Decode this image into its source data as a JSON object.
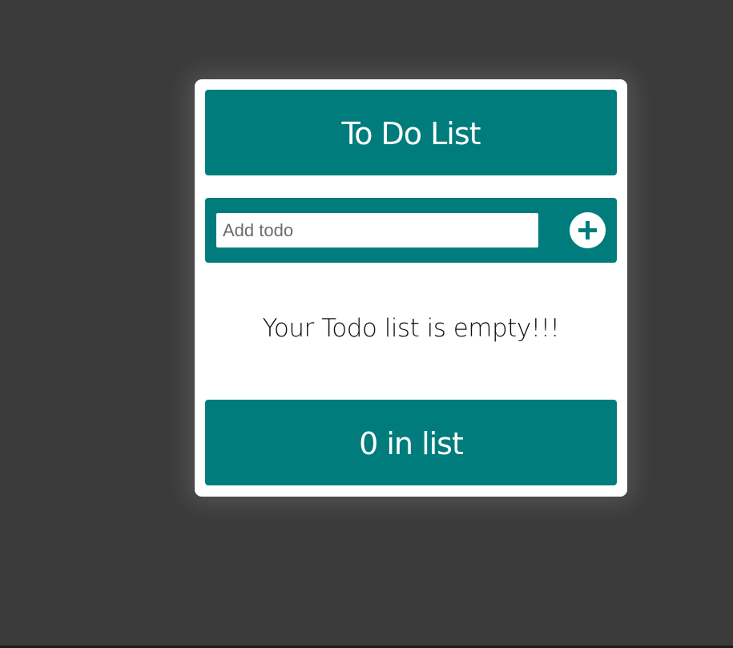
{
  "app": {
    "title": "To Do List"
  },
  "input": {
    "placeholder": "Add todo",
    "value": ""
  },
  "add_button": {
    "icon": "plus-icon"
  },
  "list": {
    "empty_message": "Your Todo list is empty!!!"
  },
  "footer": {
    "count_text": "0 in list"
  },
  "colors": {
    "background": "#3b3b3b",
    "accent": "#007c7c",
    "card": "#ffffff"
  }
}
